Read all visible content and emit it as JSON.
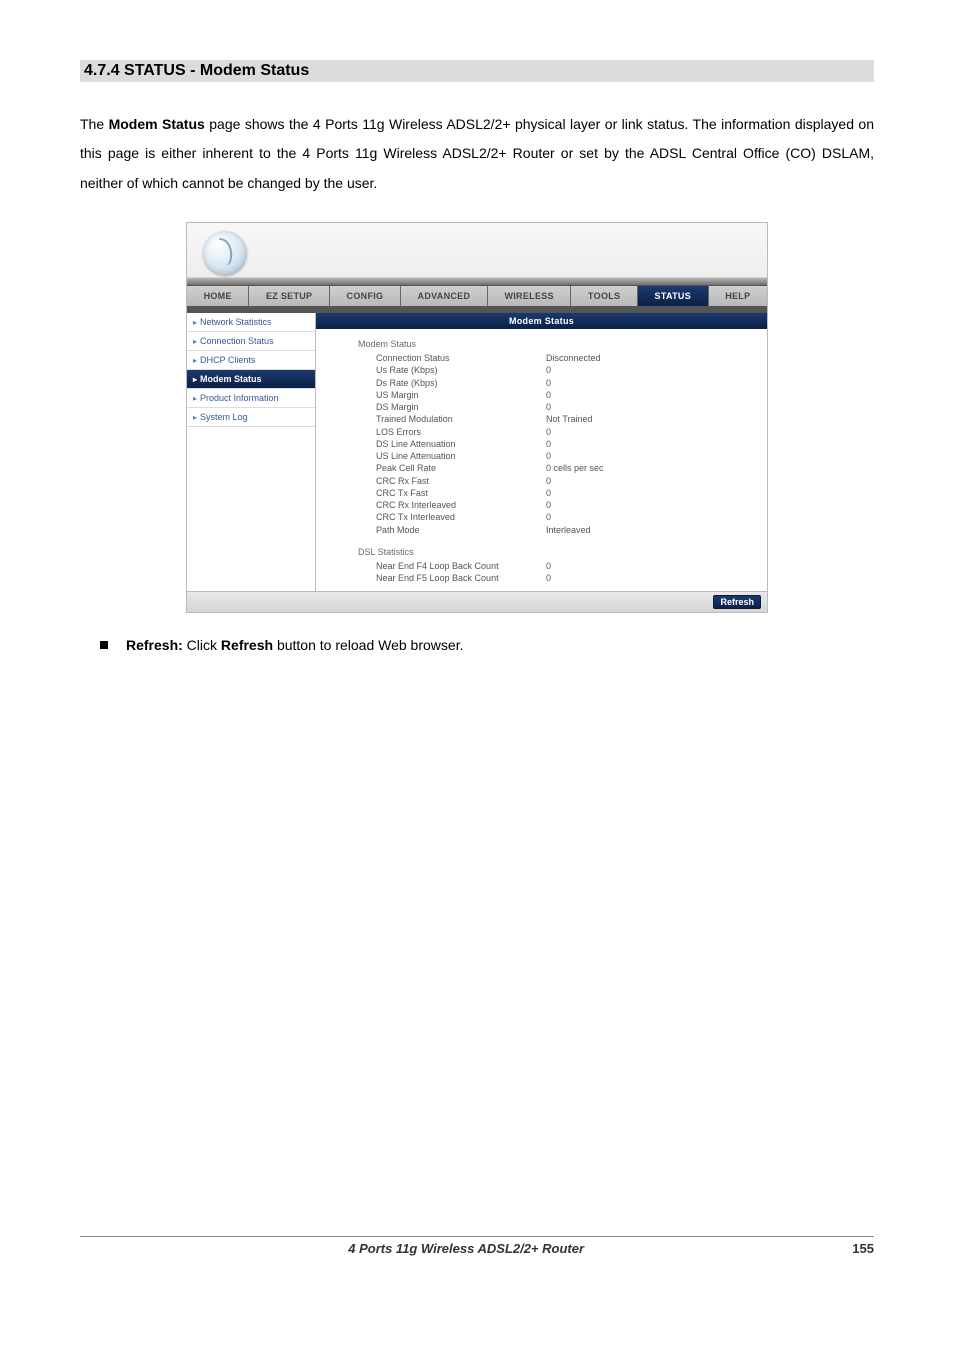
{
  "section_title": "4.7.4 STATUS - Modem Status",
  "intro": {
    "part1": "The ",
    "bold1": "Modem Status",
    "part2": " page shows the 4 Ports 11g Wireless ADSL2/2+ physical layer or link status. The information displayed on this page is either inherent to the 4 Ports 11g Wireless ADSL2/2+ Router or set by the ADSL Central Office (CO) DSLAM, neither of which cannot be changed by the user."
  },
  "tabs": [
    "HOME",
    "EZ SETUP",
    "CONFIG",
    "ADVANCED",
    "WIRELESS",
    "TOOLS",
    "STATUS",
    "HELP"
  ],
  "active_tab": "STATUS",
  "sidebar": [
    {
      "label": "Network Statistics",
      "active": false
    },
    {
      "label": "Connection Status",
      "active": false
    },
    {
      "label": "DHCP Clients",
      "active": false
    },
    {
      "label": "Modem Status",
      "active": true
    },
    {
      "label": "Product Information",
      "active": false
    },
    {
      "label": "System Log",
      "active": false
    }
  ],
  "pane_title": "Modem Status",
  "group1_title": "Modem Status",
  "group1_rows": [
    {
      "k": "Connection Status",
      "v": "Disconnected"
    },
    {
      "k": "Us Rate (Kbps)",
      "v": "0"
    },
    {
      "k": "Ds Rate (Kbps)",
      "v": "0"
    },
    {
      "k": "US Margin",
      "v": "0"
    },
    {
      "k": "DS Margin",
      "v": "0"
    },
    {
      "k": "Trained Modulation",
      "v": "Not Trained"
    },
    {
      "k": "LOS Errors",
      "v": "0"
    },
    {
      "k": "DS Line Attenuation",
      "v": "0"
    },
    {
      "k": "US Line Attenuation",
      "v": "0"
    },
    {
      "k": "Peak Cell Rate",
      "v": "0 cells per sec"
    },
    {
      "k": "CRC Rx Fast",
      "v": "0"
    },
    {
      "k": "CRC Tx Fast",
      "v": "0"
    },
    {
      "k": "CRC Rx Interleaved",
      "v": "0"
    },
    {
      "k": "CRC Tx Interleaved",
      "v": "0"
    },
    {
      "k": "Path Mode",
      "v": "Interleaved"
    }
  ],
  "group2_title": "DSL Statistics",
  "group2_rows": [
    {
      "k": "Near End F4 Loop Back Count",
      "v": "0"
    },
    {
      "k": "Near End F5 Loop Back Count",
      "v": "0"
    }
  ],
  "refresh_label": "Refresh",
  "bullet": {
    "bold1": "Refresh:",
    "mid": " Click ",
    "bold2": "Refresh",
    "tail": " button to reload Web browser."
  },
  "footer": {
    "center": "4 Ports 11g Wireless ADSL2/2+ Router",
    "page": "155"
  }
}
